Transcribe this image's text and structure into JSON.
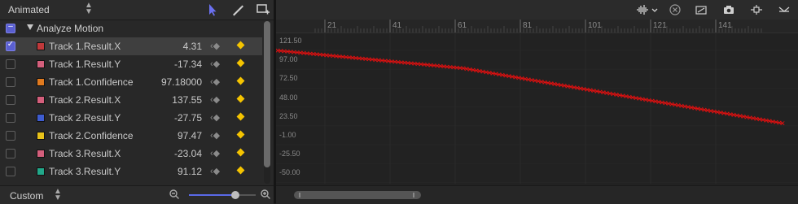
{
  "filter": {
    "label": "Animated"
  },
  "group": {
    "label": "Analyze Motion"
  },
  "parameters": [
    {
      "name": "Track 1.Result.X",
      "value": "4.31",
      "color": "#c0393b",
      "checked": true,
      "selected": true
    },
    {
      "name": "Track 1.Result.Y",
      "value": "-17.34",
      "color": "#d45f7c",
      "checked": false,
      "selected": false
    },
    {
      "name": "Track 1.Confidence",
      "value": "97.18000",
      "color": "#e07a1f",
      "checked": false,
      "selected": false
    },
    {
      "name": "Track 2.Result.X",
      "value": "137.55",
      "color": "#d45f7c",
      "checked": false,
      "selected": false
    },
    {
      "name": "Track 2.Result.Y",
      "value": "-27.75",
      "color": "#3e5ccf",
      "checked": false,
      "selected": false
    },
    {
      "name": "Track 2.Confidence",
      "value": "97.47",
      "color": "#e8c21a",
      "checked": false,
      "selected": false
    },
    {
      "name": "Track 3.Result.X",
      "value": "-23.04",
      "color": "#d45f7c",
      "checked": false,
      "selected": false
    },
    {
      "name": "Track 3.Result.Y",
      "value": "91.12",
      "color": "#22a88a",
      "checked": false,
      "selected": false
    }
  ],
  "curve_set": {
    "label": "Custom"
  },
  "zoom": {
    "level": 0.7
  },
  "timeline": {
    "ticks": [
      "21",
      "41",
      "61",
      "81",
      "101",
      "121",
      "141"
    ]
  },
  "value_axis": {
    "labels": [
      "121.50",
      "97.00",
      "72.50",
      "48.00",
      "23.50",
      "-1.00",
      "-25.50",
      "-50.00"
    ]
  },
  "colors": {
    "accent": "#5a5fd0",
    "curve": "#e01010",
    "keyframe": "#f5c400"
  },
  "icons": {
    "select_tool": "arrow-select-icon",
    "pen_tool": "pen-icon",
    "add_keyframe": "add-box-icon",
    "audio": "audio-waveform-icon",
    "clear": "clear-circle-icon",
    "fit": "fit-curves-icon",
    "snapshot": "camera-icon",
    "snap": "snap-icon"
  }
}
